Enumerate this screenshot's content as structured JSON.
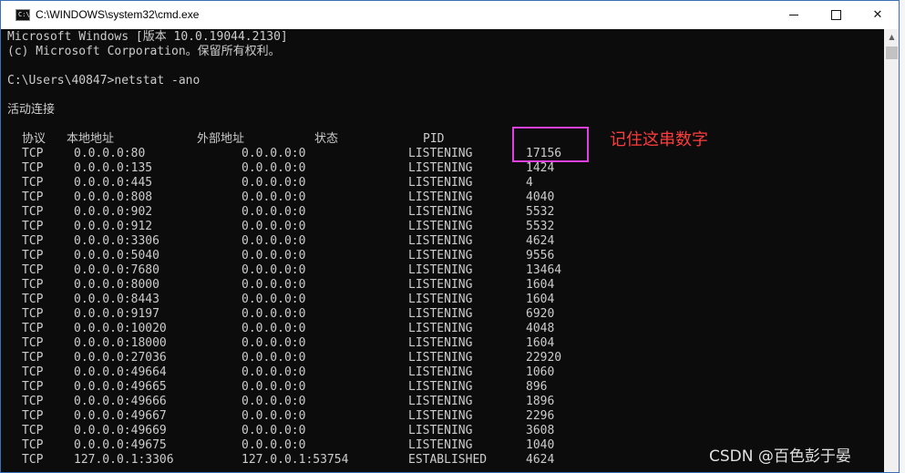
{
  "window": {
    "title": "C:\\WINDOWS\\system32\\cmd.exe",
    "icon": "cmd-icon",
    "controls": {
      "minimize": "minimize-icon",
      "maximize": "maximize-icon",
      "close": "✕"
    }
  },
  "console": {
    "header_lines": [
      "Microsoft Windows [版本 10.0.19044.2130]",
      "(c) Microsoft Corporation。保留所有权利。",
      "",
      "C:\\Users\\40847>netstat -ano",
      "",
      "活动连接"
    ],
    "columns": {
      "proto": "协议",
      "local": "本地地址",
      "foreign": "外部地址",
      "state": "状态",
      "pid": "PID"
    },
    "rows": [
      {
        "proto": "TCP",
        "local": "0.0.0.0:80",
        "foreign": "0.0.0.0:0",
        "state": "LISTENING",
        "pid": "17156"
      },
      {
        "proto": "TCP",
        "local": "0.0.0.0:135",
        "foreign": "0.0.0.0:0",
        "state": "LISTENING",
        "pid": "1424"
      },
      {
        "proto": "TCP",
        "local": "0.0.0.0:445",
        "foreign": "0.0.0.0:0",
        "state": "LISTENING",
        "pid": "4"
      },
      {
        "proto": "TCP",
        "local": "0.0.0.0:808",
        "foreign": "0.0.0.0:0",
        "state": "LISTENING",
        "pid": "4040"
      },
      {
        "proto": "TCP",
        "local": "0.0.0.0:902",
        "foreign": "0.0.0.0:0",
        "state": "LISTENING",
        "pid": "5532"
      },
      {
        "proto": "TCP",
        "local": "0.0.0.0:912",
        "foreign": "0.0.0.0:0",
        "state": "LISTENING",
        "pid": "5532"
      },
      {
        "proto": "TCP",
        "local": "0.0.0.0:3306",
        "foreign": "0.0.0.0:0",
        "state": "LISTENING",
        "pid": "4624"
      },
      {
        "proto": "TCP",
        "local": "0.0.0.0:5040",
        "foreign": "0.0.0.0:0",
        "state": "LISTENING",
        "pid": "9556"
      },
      {
        "proto": "TCP",
        "local": "0.0.0.0:7680",
        "foreign": "0.0.0.0:0",
        "state": "LISTENING",
        "pid": "13464"
      },
      {
        "proto": "TCP",
        "local": "0.0.0.0:8000",
        "foreign": "0.0.0.0:0",
        "state": "LISTENING",
        "pid": "1604"
      },
      {
        "proto": "TCP",
        "local": "0.0.0.0:8443",
        "foreign": "0.0.0.0:0",
        "state": "LISTENING",
        "pid": "1604"
      },
      {
        "proto": "TCP",
        "local": "0.0.0.0:9197",
        "foreign": "0.0.0.0:0",
        "state": "LISTENING",
        "pid": "6920"
      },
      {
        "proto": "TCP",
        "local": "0.0.0.0:10020",
        "foreign": "0.0.0.0:0",
        "state": "LISTENING",
        "pid": "4048"
      },
      {
        "proto": "TCP",
        "local": "0.0.0.0:18000",
        "foreign": "0.0.0.0:0",
        "state": "LISTENING",
        "pid": "1604"
      },
      {
        "proto": "TCP",
        "local": "0.0.0.0:27036",
        "foreign": "0.0.0.0:0",
        "state": "LISTENING",
        "pid": "22920"
      },
      {
        "proto": "TCP",
        "local": "0.0.0.0:49664",
        "foreign": "0.0.0.0:0",
        "state": "LISTENING",
        "pid": "1060"
      },
      {
        "proto": "TCP",
        "local": "0.0.0.0:49665",
        "foreign": "0.0.0.0:0",
        "state": "LISTENING",
        "pid": "896"
      },
      {
        "proto": "TCP",
        "local": "0.0.0.0:49666",
        "foreign": "0.0.0.0:0",
        "state": "LISTENING",
        "pid": "1896"
      },
      {
        "proto": "TCP",
        "local": "0.0.0.0:49667",
        "foreign": "0.0.0.0:0",
        "state": "LISTENING",
        "pid": "2296"
      },
      {
        "proto": "TCP",
        "local": "0.0.0.0:49669",
        "foreign": "0.0.0.0:0",
        "state": "LISTENING",
        "pid": "3608"
      },
      {
        "proto": "TCP",
        "local": "0.0.0.0:49675",
        "foreign": "0.0.0.0:0",
        "state": "LISTENING",
        "pid": "1040"
      },
      {
        "proto": "TCP",
        "local": "127.0.0.1:3306",
        "foreign": "127.0.0.1:53754",
        "state": "ESTABLISHED",
        "pid": "4624"
      }
    ]
  },
  "annotation": {
    "text": "记住这串数字",
    "color": "#ff3c3c",
    "box_color": "#e040e0"
  },
  "watermark": "CSDN @百色彭于晏",
  "colors": {
    "console_bg": "#0c0c0c",
    "console_text": "#cccccc",
    "titlebar_bg": "#ffffff"
  }
}
